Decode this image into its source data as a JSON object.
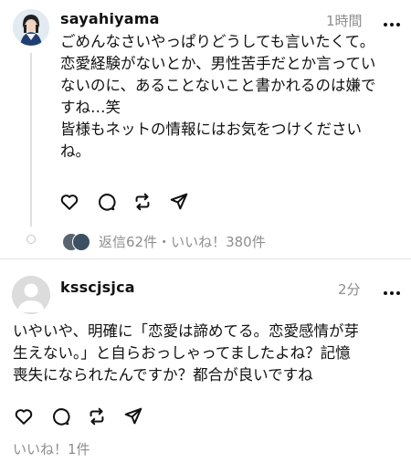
{
  "main_post": {
    "username": "sayahiyama",
    "timestamp": "1時間",
    "body_lines": [
      "ごめんなさいやっぱりどうしても言いたくて。",
      "恋愛経験がないとか、男性苦手だとか言ってい",
      "ないのに、あることないこと書かれるのは嫌で",
      "すね…笑",
      "皆様もネットの情報にはお気をつけください",
      "ね。"
    ],
    "stats": "返信62件・いいね！380件"
  },
  "reply_post": {
    "username": "ksscjsjca",
    "timestamp": "2分",
    "body_lines": [
      "いやいや、明確に「恋愛は諦めてる。恋愛感情が芽",
      "生えない。」と自らおっしゃってましたよね？記憶",
      "喪失になられたんですか？都合が良いですね"
    ],
    "likes": "いいね！1件"
  },
  "icons": {
    "like": "heart-icon",
    "reply": "comment-icon",
    "repost": "repost-icon",
    "share": "send-icon",
    "more": "more-icon"
  },
  "colors": {
    "text": "#111111",
    "muted": "#8e8e8e",
    "divider": "#e4e4e4"
  }
}
